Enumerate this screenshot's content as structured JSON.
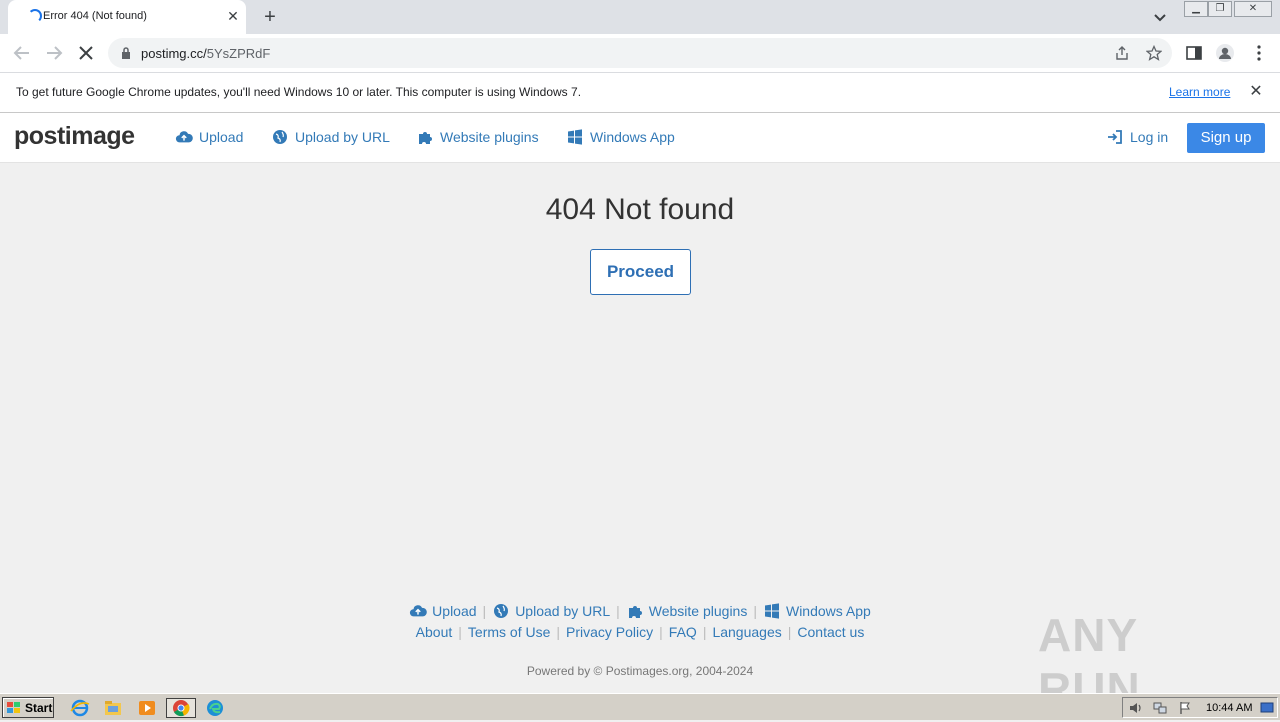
{
  "browser": {
    "tab_title": "Error 404 (Not found)",
    "url_host": "postimg.cc/",
    "url_path": "5YsZPRdF"
  },
  "infobar": {
    "message": "To get future Google Chrome updates, you'll need Windows 10 or later. This computer is using Windows 7.",
    "learn_more": "Learn more"
  },
  "site": {
    "logo_main": "post",
    "logo_accent": "image",
    "nav": {
      "upload": "Upload",
      "upload_by_url": "Upload by URL",
      "website_plugins": "Website plugins",
      "windows_app": "Windows App",
      "log_in": "Log in",
      "sign_up": "Sign up"
    }
  },
  "main": {
    "heading": "404 Not found",
    "proceed": "Proceed"
  },
  "footer": {
    "row1": [
      "Upload",
      "Upload by URL",
      "Website plugins",
      "Windows App"
    ],
    "row2": [
      "About",
      "Terms of Use",
      "Privacy Policy",
      "FAQ",
      "Languages",
      "Contact us"
    ],
    "powered": "Powered by © Postimages.org, 2004-2024"
  },
  "watermark": "ANY RUN",
  "taskbar": {
    "start": "Start",
    "clock": "10:44 AM"
  },
  "colors": {
    "link": "#337ab7",
    "primary_button": "#3b88e6",
    "chrome_blue": "#1a73e8"
  }
}
